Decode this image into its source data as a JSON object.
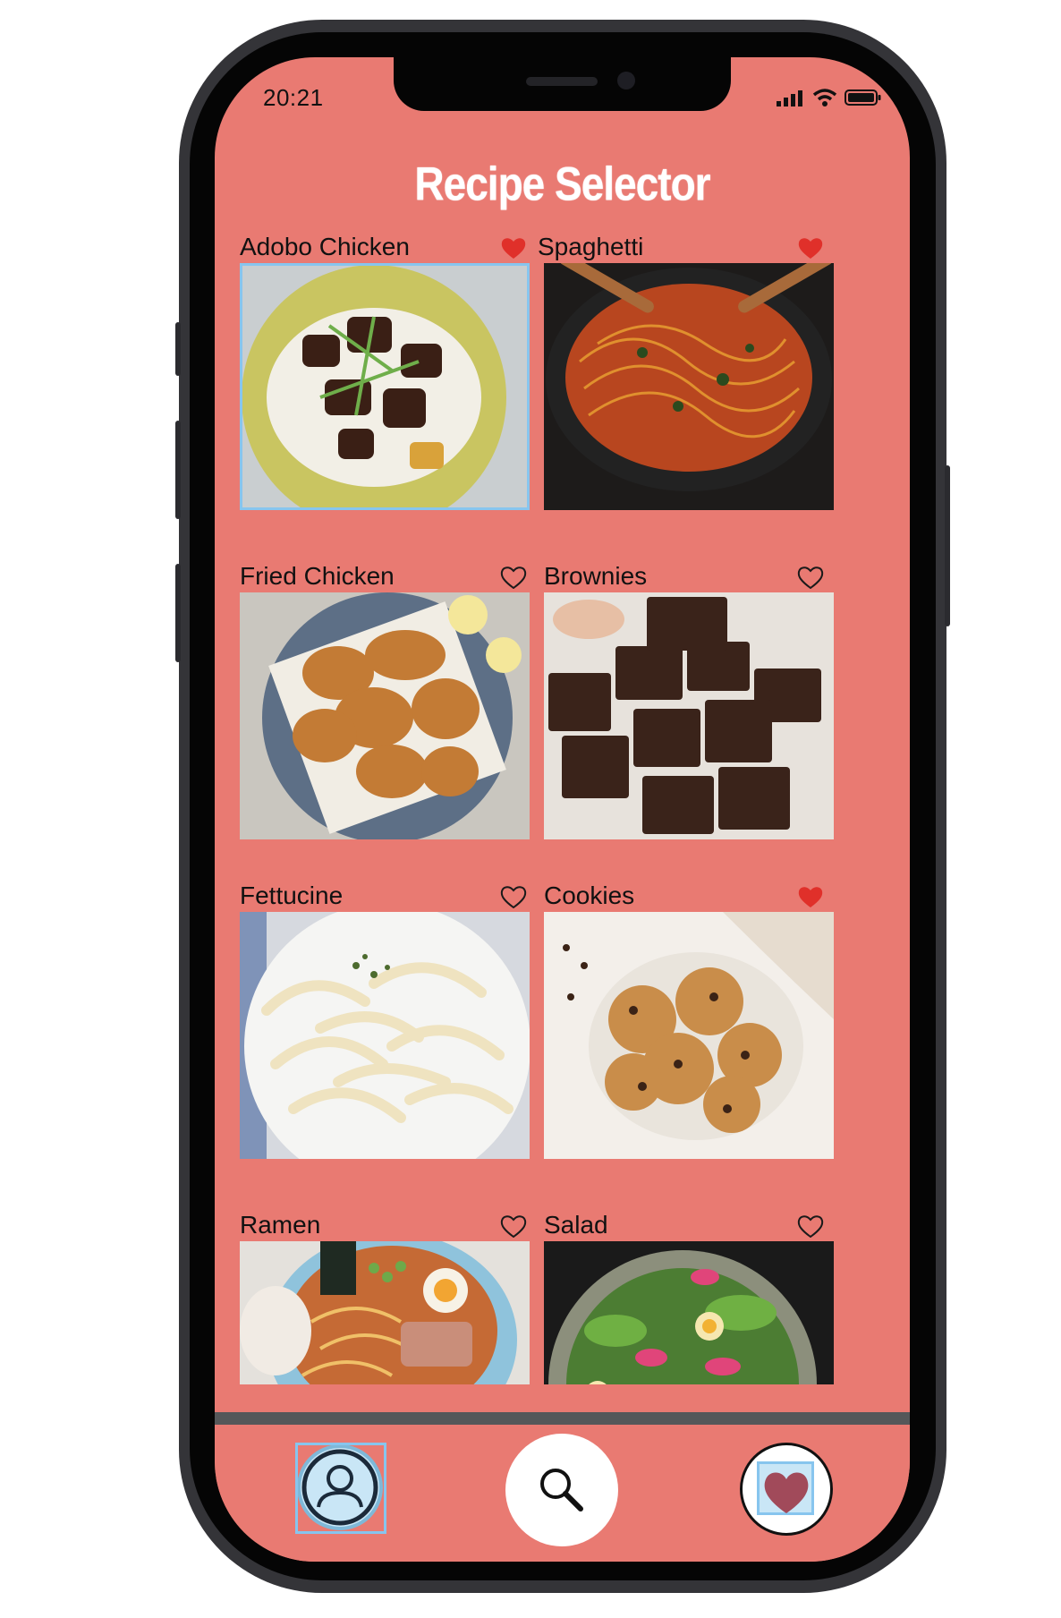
{
  "status_bar": {
    "time": "20:21"
  },
  "header": {
    "title": "Recipe Selector"
  },
  "colors": {
    "background": "#e97a72",
    "heart_filled": "#e0302a",
    "heart_outline": "#1a1a1a",
    "selection": "#87c5ee",
    "favorites_heart": "#a14a5a"
  },
  "recipes": [
    {
      "name": "Adobo Chicken",
      "favorite": true,
      "selected": true,
      "image": "adobo-chicken-photo"
    },
    {
      "name": "Spaghetti",
      "favorite": true,
      "selected": false,
      "image": "spaghetti-photo"
    },
    {
      "name": "Fried Chicken",
      "favorite": false,
      "selected": false,
      "image": "fried-chicken-photo"
    },
    {
      "name": "Brownies",
      "favorite": false,
      "selected": false,
      "image": "brownies-photo"
    },
    {
      "name": "Fettucine",
      "favorite": false,
      "selected": false,
      "image": "fettucine-photo"
    },
    {
      "name": "Cookies",
      "favorite": true,
      "selected": false,
      "image": "cookies-photo"
    },
    {
      "name": "Ramen",
      "favorite": false,
      "selected": false,
      "image": "ramen-photo"
    },
    {
      "name": "Salad",
      "favorite": false,
      "selected": false,
      "image": "salad-photo"
    }
  ],
  "tab_bar": {
    "items": [
      {
        "icon": "profile-icon",
        "selected": true
      },
      {
        "icon": "search-icon",
        "selected": false
      },
      {
        "icon": "favorites-heart-icon",
        "selected": true
      }
    ]
  }
}
